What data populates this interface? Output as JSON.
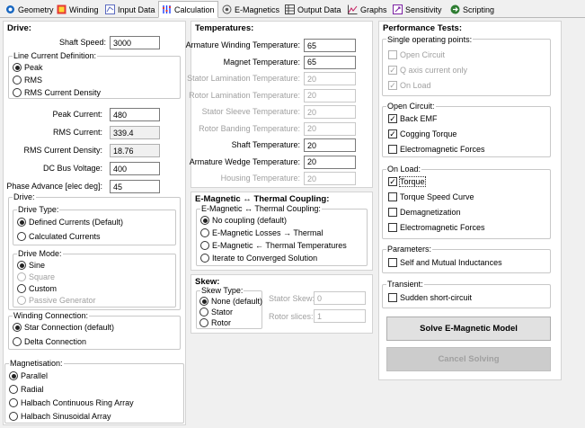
{
  "tabs": [
    {
      "label": "Geometry",
      "icon": "gear-icon",
      "color": "#1565c0"
    },
    {
      "label": "Winding",
      "icon": "winding-icon",
      "color": "#e53935"
    },
    {
      "label": "Input Data",
      "icon": "input-data-icon",
      "color": "#5c6bc0"
    },
    {
      "label": "Calculation",
      "icon": "calculation-icon",
      "color": "#1e40ff",
      "active": true
    },
    {
      "label": "E-Magnetics",
      "icon": "e-magnetics-icon",
      "color": "#555555"
    },
    {
      "label": "Output Data",
      "icon": "output-data-icon",
      "color": "#444444"
    },
    {
      "label": "Graphs",
      "icon": "graphs-icon",
      "color": "#c2185b"
    },
    {
      "label": "Sensitivity",
      "icon": "sensitivity-icon",
      "color": "#7b1fa2"
    },
    {
      "label": "Scripting",
      "icon": "scripting-icon",
      "color": "#2e7d32"
    }
  ],
  "drive": {
    "title": "Drive:",
    "shaft_speed_label": "Shaft Speed:",
    "shaft_speed": "3000",
    "line_current_def": {
      "legend": "Line Current Definition:",
      "options": [
        {
          "label": "Peak",
          "selected": true
        },
        {
          "label": "RMS",
          "selected": false
        },
        {
          "label": "RMS Current Density",
          "selected": false
        }
      ]
    },
    "peak_current_label": "Peak Current:",
    "peak_current": "480",
    "rms_current_label": "RMS Current:",
    "rms_current": "339.4",
    "rms_density_label": "RMS Current Density:",
    "rms_density": "18.76",
    "dc_bus_label": "DC Bus Voltage:",
    "dc_bus": "400",
    "phase_adv_label": "Phase Advance [elec deg]:",
    "phase_adv": "45",
    "drive_group": {
      "legend": "Drive:",
      "drive_type": {
        "legend": "Drive Type:",
        "options": [
          {
            "label": "Defined Currents (Default)",
            "selected": true
          },
          {
            "label": "Calculated Currents",
            "selected": false
          }
        ]
      },
      "drive_mode": {
        "legend": "Drive Mode:",
        "options": [
          {
            "label": "Sine",
            "selected": true,
            "disabled": false
          },
          {
            "label": "Square",
            "selected": false,
            "disabled": true
          },
          {
            "label": "Custom",
            "selected": false,
            "disabled": false
          },
          {
            "label": "Passive Generator",
            "selected": false,
            "disabled": true
          }
        ]
      }
    },
    "winding_connection": {
      "legend": "Winding Connection:",
      "options": [
        {
          "label": "Star Connection (default)",
          "selected": true
        },
        {
          "label": "Delta Connection",
          "selected": false
        }
      ]
    },
    "magnetisation": {
      "legend": "Magnetisation:",
      "options": [
        {
          "label": "Parallel",
          "selected": true
        },
        {
          "label": "Radial",
          "selected": false
        },
        {
          "label": "Halbach Continuous Ring Array",
          "selected": false
        },
        {
          "label": "Halbach Sinusoidal Array",
          "selected": false
        }
      ]
    }
  },
  "temperatures": {
    "title": "Temperatures:",
    "rows": [
      {
        "label": "Armature Winding Temperature:",
        "value": "65",
        "disabled": false
      },
      {
        "label": "Magnet Temperature:",
        "value": "65",
        "disabled": false
      },
      {
        "label": "Stator Lamination Temperature:",
        "value": "20",
        "disabled": true
      },
      {
        "label": "Rotor Lamination Temperature:",
        "value": "20",
        "disabled": true
      },
      {
        "label": "Stator Sleeve Temperature:",
        "value": "20",
        "disabled": true
      },
      {
        "label": "Rotor Banding Temperature:",
        "value": "20",
        "disabled": true
      },
      {
        "label": "Shaft Temperature:",
        "value": "20",
        "disabled": false
      },
      {
        "label": "Armature Wedge Temperature:",
        "value": "20",
        "disabled": false
      },
      {
        "label": "Housing Temperature:",
        "value": "20",
        "disabled": true
      }
    ]
  },
  "coupling": {
    "title": "E-Magnetic ↔ Thermal Coupling:",
    "legend": "E-Magnetic ↔ Thermal Coupling:",
    "options": [
      {
        "label": "No coupling (default)",
        "selected": true
      },
      {
        "label": "E-Magnetic Losses → Thermal",
        "selected": false
      },
      {
        "label": "E-Magnetic  ← Thermal Temperatures",
        "selected": false
      },
      {
        "label": "Iterate to Converged Solution",
        "selected": false
      }
    ]
  },
  "skew": {
    "title": "Skew:",
    "legend": "Skew Type:",
    "options": [
      {
        "label": "None (default)",
        "selected": true
      },
      {
        "label": "Stator",
        "selected": false
      },
      {
        "label": "Rotor",
        "selected": false
      }
    ],
    "stator_skew_label": "Stator Skew:",
    "stator_skew": "0",
    "rotor_slices_label": "Rotor slices:",
    "rotor_slices": "1"
  },
  "perf": {
    "title": "Performance Tests:",
    "single": {
      "legend": "Single operating points:",
      "items": [
        {
          "label": "Open Circuit",
          "checked": false
        },
        {
          "label": "Q axis current only",
          "checked": true
        },
        {
          "label": "On Load",
          "checked": true
        }
      ]
    },
    "open_circuit": {
      "legend": "Open Circuit:",
      "items": [
        {
          "label": "Back EMF",
          "checked": true
        },
        {
          "label": "Cogging Torque",
          "checked": true
        },
        {
          "label": "Electromagnetic Forces",
          "checked": false
        }
      ]
    },
    "on_load": {
      "legend": "On Load:",
      "items": [
        {
          "label": "Torque",
          "checked": true
        },
        {
          "label": "Torque Speed Curve",
          "checked": false
        },
        {
          "label": "Demagnetization",
          "checked": false
        },
        {
          "label": "Electromagnetic Forces",
          "checked": false
        }
      ]
    },
    "parameters": {
      "legend": "Parameters:",
      "items": [
        {
          "label": "Self and Mutual Inductances",
          "checked": false
        }
      ]
    },
    "transient": {
      "legend": "Transient:",
      "items": [
        {
          "label": "Sudden short-circuit",
          "checked": false
        }
      ]
    },
    "solve_label": "Solve E-Magnetic Model",
    "cancel_label": "Cancel Solving"
  }
}
